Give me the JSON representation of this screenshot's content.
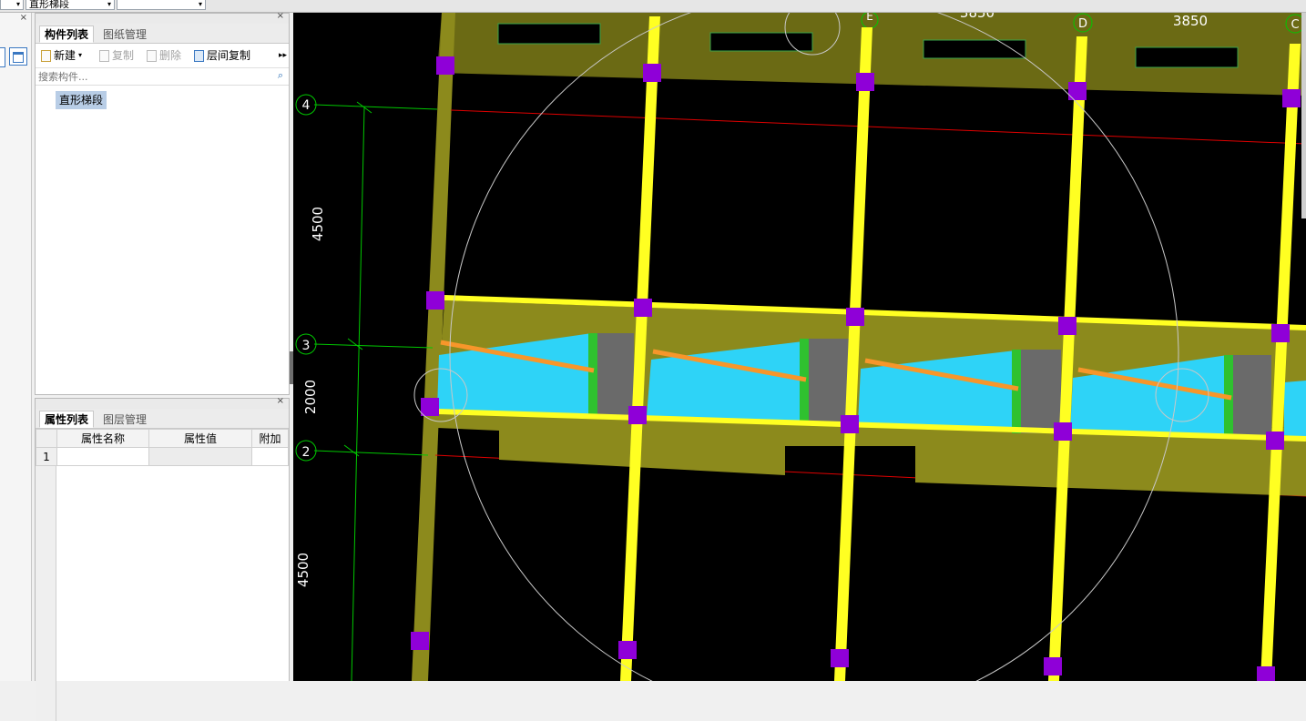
{
  "topbar": {
    "combo1_value": "",
    "combo2_value": "直形梯段",
    "combo3_value": ""
  },
  "component_panel": {
    "tabs": [
      "构件列表",
      "图纸管理"
    ],
    "toolbar": {
      "new_label": "新建",
      "copy_label": "复制",
      "delete_label": "删除",
      "floor_copy_label": "层间复制"
    },
    "search_placeholder": "搜索构件...",
    "tree_item": "直形梯段"
  },
  "property_panel": {
    "tabs": [
      "属性列表",
      "图层管理"
    ],
    "columns": [
      "属性名称",
      "属性值",
      "附加"
    ],
    "row_numbers": [
      "1"
    ]
  },
  "viewport": {
    "dims": [
      "3850",
      "3850",
      "4500",
      "2000",
      "4500"
    ],
    "axis_labels": [
      "4",
      "3",
      "2",
      "D",
      "C",
      "E"
    ],
    "colors": {
      "background": "#000000",
      "slab": "#8c8a1c",
      "column": "#ffff22",
      "post": "#8f00d8",
      "stair": "#2ed3f7",
      "rail": "#f7962a",
      "grid_line": "#00c800",
      "red_line": "#e00000"
    }
  }
}
